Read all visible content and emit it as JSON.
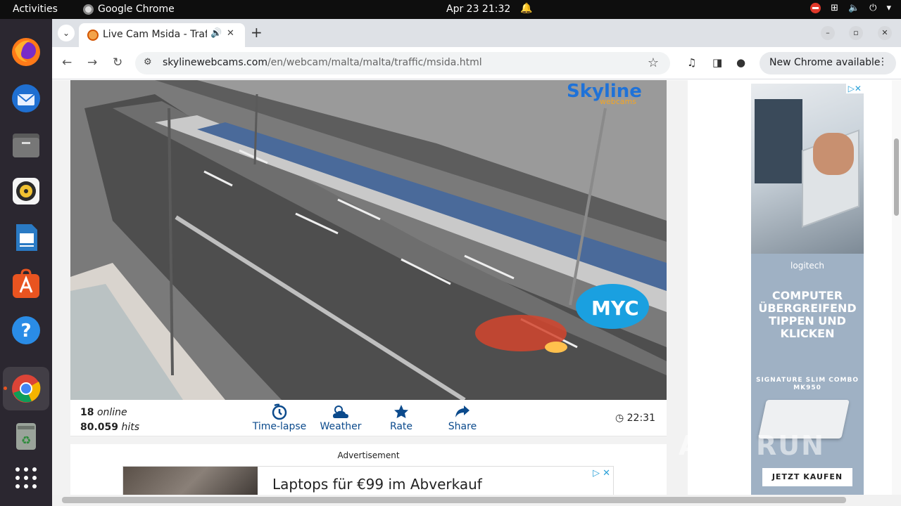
{
  "system": {
    "activities": "Activities",
    "app_name": "Google Chrome",
    "datetime": "Apr 23  21:32"
  },
  "browser": {
    "tab_title": "Live Cam Msida - Traffic",
    "new_tab": "+",
    "url_domain": "skylinewebcams.com",
    "url_path": "/en/webcam/malta/malta/traffic/msida.html",
    "update_label": "New Chrome available"
  },
  "webcam": {
    "logo_top": "Skyline",
    "logo_bottom": "webcams",
    "overlay_brand": "MYC"
  },
  "infobar": {
    "online_count": "18",
    "online_label": "online",
    "hits_count": "80.059",
    "hits_label": "hits",
    "actions": [
      "Time-lapse",
      "Weather",
      "Rate",
      "Share"
    ],
    "time": "22:31"
  },
  "ads": {
    "label": "Advertisement",
    "banner_text": "Laptops für €99 im Abverkauf",
    "side_brand": "logitech",
    "side_headline": "COMPUTER ÜBERGREIFEND TIPPEN UND KLICKEN",
    "side_product": "SIGNATURE SLIM COMBO MK950",
    "side_cta": "JETZT KAUFEN"
  },
  "watermark": "ANY RUN"
}
